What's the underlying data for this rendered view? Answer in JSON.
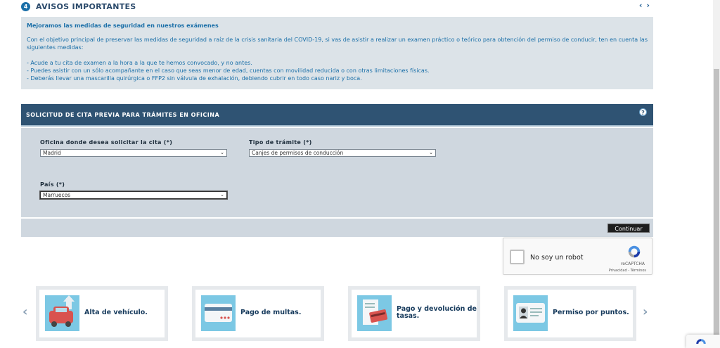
{
  "avisos": {
    "number": "4",
    "title": "AVISOS IMPORTANTES",
    "prev_arrow": "‹",
    "next_arrow": "›",
    "heading": "Mejoramos las medidas de seguridad en nuestros exámenes",
    "intro": "Con el objetivo principal de preservar las medidas de seguridad a raíz de la crisis sanitaria del COVID-19, si vas de asistir a realizar un examen práctico o teórico para obtención del permiso de conducir, ten en cuenta las siguientes medidas:",
    "items": [
      "- Acude a tu cita de examen a la hora a la que te hemos convocado, y no antes.",
      "- Puedes asistir con un sólo acompañante en el caso que seas menor de edad, cuentas con movilidad reducida o con otras limitaciones físicas.",
      "- Deberás llevar una mascarilla quirúrgica o FFP2 sin válvula de exhalación, debiendo cubrir en todo caso nariz y boca."
    ]
  },
  "form": {
    "title": "SOLICITUD DE CITA PREVIA PARA TRÁMITES EN OFICINA",
    "help_icon": "?",
    "oficina_label": "Oficina donde desea solicitar la cita (*)",
    "oficina_value": "Madrid",
    "tramite_label": "Tipo de trámite (*)",
    "tramite_value": "Canjes de permisos de conducción",
    "pais_label": "País (*)",
    "pais_value": "Marruecos",
    "continue_label": "Continuar"
  },
  "recaptcha": {
    "label": "No soy un robot",
    "brand": "reCAPTCHA",
    "links": "Privacidad - Términos"
  },
  "cards": [
    {
      "label": "Alta de vehículo.",
      "icon": "car-upload-icon"
    },
    {
      "label": "Pago de multas.",
      "icon": "card-payment-icon"
    },
    {
      "label": "Pago y devolución de tasas.",
      "icon": "receipt-card-icon"
    },
    {
      "label": "Permiso por puntos.",
      "icon": "id-card-icon"
    }
  ],
  "carousel": {
    "prev": "‹",
    "next": "›"
  },
  "colors": {
    "header_bg": "#2f5373",
    "panel_bg": "#cfd7df",
    "notice_bg": "#dce3e8",
    "notice_text": "#1a6fa8",
    "card_icon_bg": "#7cc8e4"
  }
}
